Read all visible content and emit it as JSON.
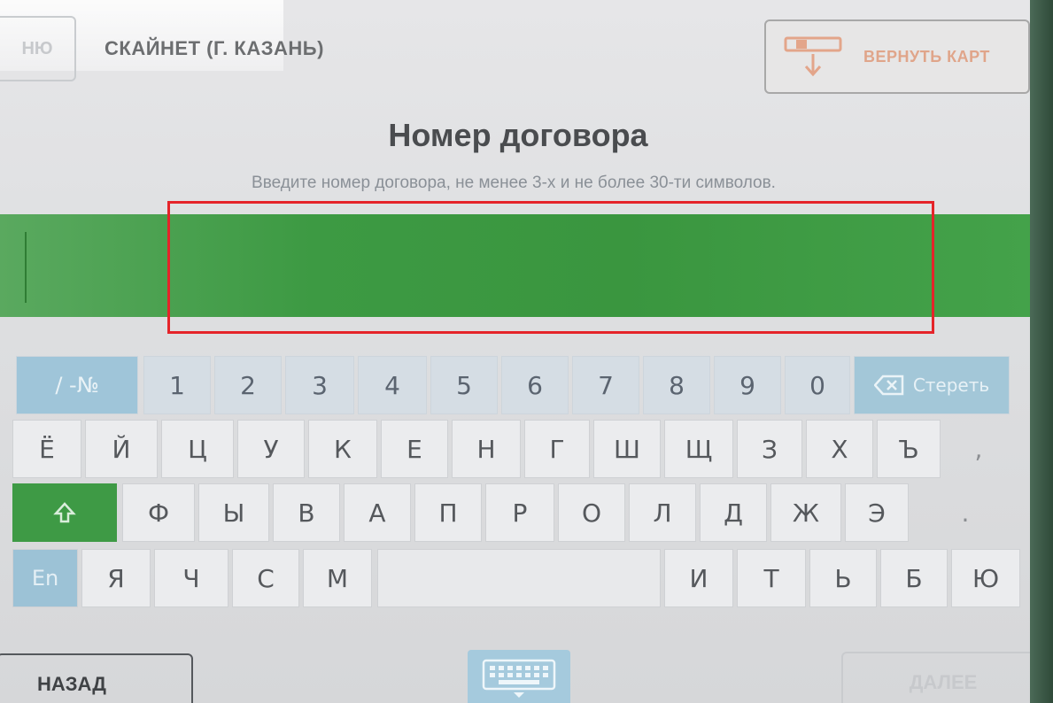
{
  "header": {
    "home_label": "НЮ",
    "provider": "СКАЙНЕТ (Г. КАЗАНЬ)",
    "return_card_label": "ВЕРНУТЬ КАРТ",
    "return_card_icon": "card-eject-icon"
  },
  "form": {
    "title": "Номер договора",
    "hint": "Введите номер договора, не менее 3-х и не более 30-ти символов.",
    "input_value": ""
  },
  "keyboard": {
    "sym_label": "/ -№",
    "backspace_label": "Стереть",
    "backspace_icon": "backspace-icon",
    "shift_icon": "shift-icon",
    "lang_label": "En",
    "row0": [
      "1",
      "2",
      "3",
      "4",
      "5",
      "6",
      "7",
      "8",
      "9",
      "0"
    ],
    "row1": [
      "Ё",
      "Й",
      "Ц",
      "У",
      "К",
      "Е",
      "Н",
      "Г",
      "Ш",
      "Щ",
      "З",
      "Х",
      "Ъ",
      ","
    ],
    "row2": [
      "Ф",
      "Ы",
      "В",
      "А",
      "П",
      "Р",
      "О",
      "Л",
      "Д",
      "Ж",
      "Э",
      "."
    ],
    "row3_left": [
      "Я",
      "Ч",
      "С",
      "М"
    ],
    "row3_right": [
      "И",
      "Т",
      "Ь",
      "Б",
      "Ю"
    ]
  },
  "footer": {
    "back_label": "НАЗАД",
    "keyboard_toggle_icon": "keyboard-icon",
    "next_label": "ДАЛЕЕ"
  },
  "colors": {
    "accent_green": "#3e9a45",
    "key_blue": "#9fc5d9",
    "highlight_red": "#e5242a"
  }
}
